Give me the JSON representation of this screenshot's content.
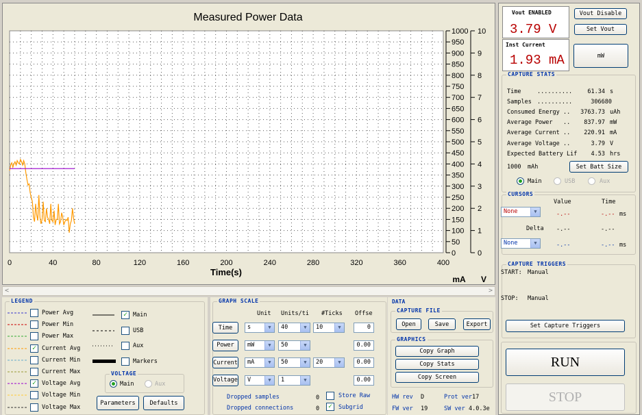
{
  "chart_data": {
    "type": "line",
    "title": "Measured Power Data",
    "xlabel": "Time(s)",
    "xlim": [
      0,
      400
    ],
    "x_ticks": [
      "0",
      "40",
      "80",
      "120",
      "160",
      "200",
      "240",
      "280",
      "320",
      "360",
      "400"
    ],
    "y_left_ticks": [
      "0",
      "50",
      "100",
      "150",
      "200",
      "250",
      "300",
      "350",
      "400",
      "450",
      "500",
      "550",
      "600",
      "650",
      "700",
      "750",
      "800",
      "850",
      "900",
      "950",
      "1000"
    ],
    "y_right_ticks": [
      "0",
      "1",
      "2",
      "3",
      "4",
      "5",
      "6",
      "7",
      "8",
      "9",
      "10"
    ],
    "y_left_unit": "mA",
    "y_right_unit": "V",
    "ylim_left": [
      0,
      1000
    ],
    "ylim_right": [
      0,
      10
    ],
    "grid": "dotted",
    "series": [
      {
        "name": "Current Avg",
        "color": "#ff9900",
        "x": [
          0,
          1,
          2,
          3,
          4,
          5,
          6,
          7,
          8,
          9,
          10,
          11,
          12,
          13,
          14,
          15,
          16,
          17,
          18,
          19,
          20,
          21,
          22,
          23,
          24,
          25,
          26,
          27,
          28,
          29,
          30,
          31,
          32,
          33,
          34,
          35,
          36,
          37,
          38,
          39,
          40,
          41,
          42,
          43,
          44,
          45,
          46,
          47,
          48,
          49,
          50,
          51,
          52,
          53,
          54,
          55,
          56,
          57,
          58,
          59,
          60
        ],
        "values": [
          370,
          395,
          405,
          385,
          400,
          410,
          395,
          415,
          405,
          400,
          420,
          410,
          395,
          415,
          400,
          360,
          330,
          305,
          310,
          270,
          250,
          230,
          160,
          140,
          220,
          170,
          145,
          260,
          160,
          130,
          150,
          230,
          145,
          140,
          200,
          160,
          150,
          130,
          220,
          145,
          140,
          190,
          125,
          150,
          150,
          220,
          130,
          140,
          180,
          160,
          125,
          140,
          150,
          145,
          160,
          90,
          130,
          145,
          200,
          155,
          130
        ]
      },
      {
        "name": "Voltage Avg",
        "color": "#9900cc",
        "x": [
          0,
          60
        ],
        "values": [
          3.79,
          3.79
        ]
      }
    ]
  },
  "right": {
    "vout_label": "Vout ENABLED",
    "vout_value": "3.79 V",
    "vout_disable": "Vout Disable",
    "set_vout": "Set Vout",
    "inst_current_label": "Inst Current",
    "inst_current_value": "1.93 mA",
    "unit_button": "mW",
    "stats_title": "CAPTURE STATS",
    "stats": [
      {
        "label": "Time",
        "dots": "..........",
        "value": "61.34",
        "unit": "s"
      },
      {
        "label": "Samples",
        "dots": "..........",
        "value": "306680",
        "unit": ""
      },
      {
        "label": "Consumed Energy",
        "dots": "..",
        "value": "3763.73",
        "unit": "uAh"
      },
      {
        "label": "Average Power",
        "dots": "..",
        "value": "837.97",
        "unit": "mW"
      },
      {
        "label": "Average Current",
        "dots": "..",
        "value": "220.91",
        "unit": "mA"
      },
      {
        "label": "Average Voltage",
        "dots": "..",
        "value": "3.79",
        "unit": "V"
      },
      {
        "label": "Expected Battery Lif",
        "dots": "",
        "value": "4.53",
        "unit": "hrs"
      }
    ],
    "batt_value": "1000",
    "batt_unit": "mAh",
    "set_batt": "Set Batt Size",
    "batt_radio": [
      "Main",
      "USB",
      "Aux"
    ],
    "cursors_title": "CURSORS",
    "cursor_value_hdr": "Value",
    "cursor_time_hdr": "Time",
    "cursor1_sel": "None",
    "cursor1_value": "-.--",
    "cursor1_time": "-.--",
    "cursor_unit": "ms",
    "delta_label": "Delta",
    "delta_value": "-.--",
    "delta_time": "-.--",
    "cursor2_sel": "None",
    "cursor2_value": "-.--",
    "cursor2_time": "-.--",
    "triggers_title": "CAPTURE TRIGGERS",
    "start_label": "START:",
    "start_value": "Manual",
    "stop_label": "STOP:",
    "stop_value": "Manual",
    "set_triggers": "Set Capture Triggers",
    "run": "RUN",
    "stop": "STOP"
  },
  "legend": {
    "title": "LEGEND",
    "items": [
      {
        "label": "Power Avg",
        "checked": false,
        "color": "#3333cc",
        "style": "dashed"
      },
      {
        "label": "Power Min",
        "checked": false,
        "color": "#cc0000",
        "style": "dashed"
      },
      {
        "label": "Power Max",
        "checked": false,
        "color": "#33aa33",
        "style": "dashed"
      },
      {
        "label": "Current Avg",
        "checked": true,
        "color": "#ff9900",
        "style": "dashed"
      },
      {
        "label": "Current Min",
        "checked": false,
        "color": "#66aacc",
        "style": "dashed"
      },
      {
        "label": "Current Max",
        "checked": false,
        "color": "#999933",
        "style": "dashed"
      },
      {
        "label": "Voltage Avg",
        "checked": true,
        "color": "#9900cc",
        "style": "dashed"
      },
      {
        "label": "Voltage Min",
        "checked": false,
        "color": "#ffcc33",
        "style": "dashed"
      },
      {
        "label": "Voltage Max",
        "checked": false,
        "color": "#333333",
        "style": "dashed"
      }
    ],
    "lines": [
      {
        "label": "Main",
        "checked": true
      },
      {
        "label": "USB",
        "checked": false
      },
      {
        "label": "Aux",
        "checked": false
      },
      {
        "label": "Markers",
        "checked": false
      }
    ],
    "voltage_title": "VOLTAGE",
    "voltage_radio": [
      "Main",
      "Aux"
    ],
    "parameters": "Parameters",
    "defaults": "Defaults"
  },
  "scale": {
    "title": "GRAPH SCALE",
    "hdr_unit": "Unit",
    "hdr_units_ti": "Units/ti",
    "hdr_ticks": "#Ticks",
    "hdr_offset": "Offse",
    "rows": [
      {
        "label": "Time",
        "unit": "s",
        "units": "40",
        "ticks": "10",
        "offset": "0"
      },
      {
        "label": "Power",
        "unit": "mW",
        "units": "50",
        "ticks": "",
        "offset": "0.00"
      },
      {
        "label": "Current",
        "unit": "mA",
        "units": "50",
        "ticks": "20",
        "offset": "0.00"
      },
      {
        "label": "Voltage",
        "unit": "V",
        "units": "1",
        "ticks": "",
        "offset": "0.00"
      }
    ],
    "dropped_samples": "Dropped samples",
    "dropped_samples_val": "0",
    "dropped_conn": "Dropped connections",
    "dropped_conn_val": "0",
    "store_raw": "Store Raw",
    "subgrid": "Subgrid"
  },
  "data": {
    "title": "DATA",
    "capture_file": "CAPTURE FILE",
    "open": "Open",
    "save": "Save",
    "export": "Export",
    "graphics": "GRAPHICS",
    "copy_graph": "Copy Graph",
    "copy_stats": "Copy Stats",
    "copy_screen": "Copy Screen",
    "hw_rev": "HW rev",
    "hw_rev_val": "D",
    "prot_ver": "Prot ver",
    "prot_ver_val": "17",
    "fw_ver": "FW ver",
    "fw_ver_val": "19",
    "sw_ver": "SW ver",
    "sw_ver_val": "4.0.3e"
  }
}
